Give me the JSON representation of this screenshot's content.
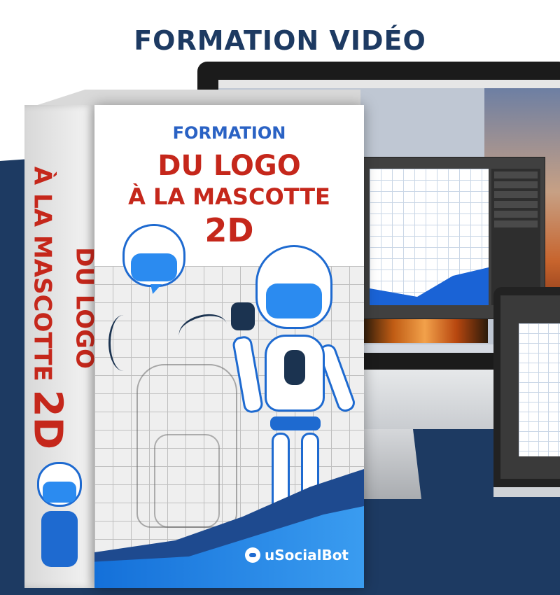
{
  "headline": "FORMATION VIDÉO",
  "box": {
    "front_small": "FORMATION",
    "front_title_line1": "DU LOGO",
    "front_title_line2": "À LA MASCOTTE",
    "front_title_line3": "2D",
    "side_line1": "DU LOGO",
    "side_line2": "À LA MASCOTTE",
    "side_2d": "2D",
    "brand": "uSocialBot"
  },
  "colors": {
    "navy": "#1d3a62",
    "red": "#c5271b",
    "blue": "#2b8bf0"
  },
  "icons": {
    "apple": "apple-logo-icon"
  }
}
